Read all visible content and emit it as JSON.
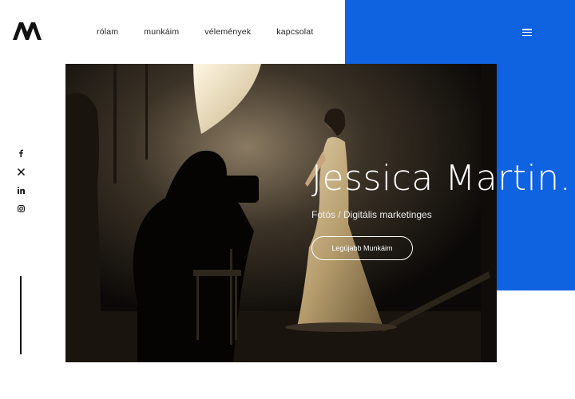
{
  "brand": {
    "logo_icon": "stylized-m-logo",
    "accent_color": "#0f62e0"
  },
  "nav": {
    "items": [
      "rólam",
      "munkáim",
      "vélemények",
      "kapcsolat"
    ],
    "menu_icon": "hamburger-menu-icon"
  },
  "social": {
    "icons": [
      "facebook-icon",
      "x-icon",
      "linkedin-icon",
      "instagram-icon"
    ]
  },
  "hero": {
    "name": "Jessica Martin.",
    "subtitle": "Fotós / Digitális marketinges",
    "cta_label": "Legújabb Munkáim"
  }
}
